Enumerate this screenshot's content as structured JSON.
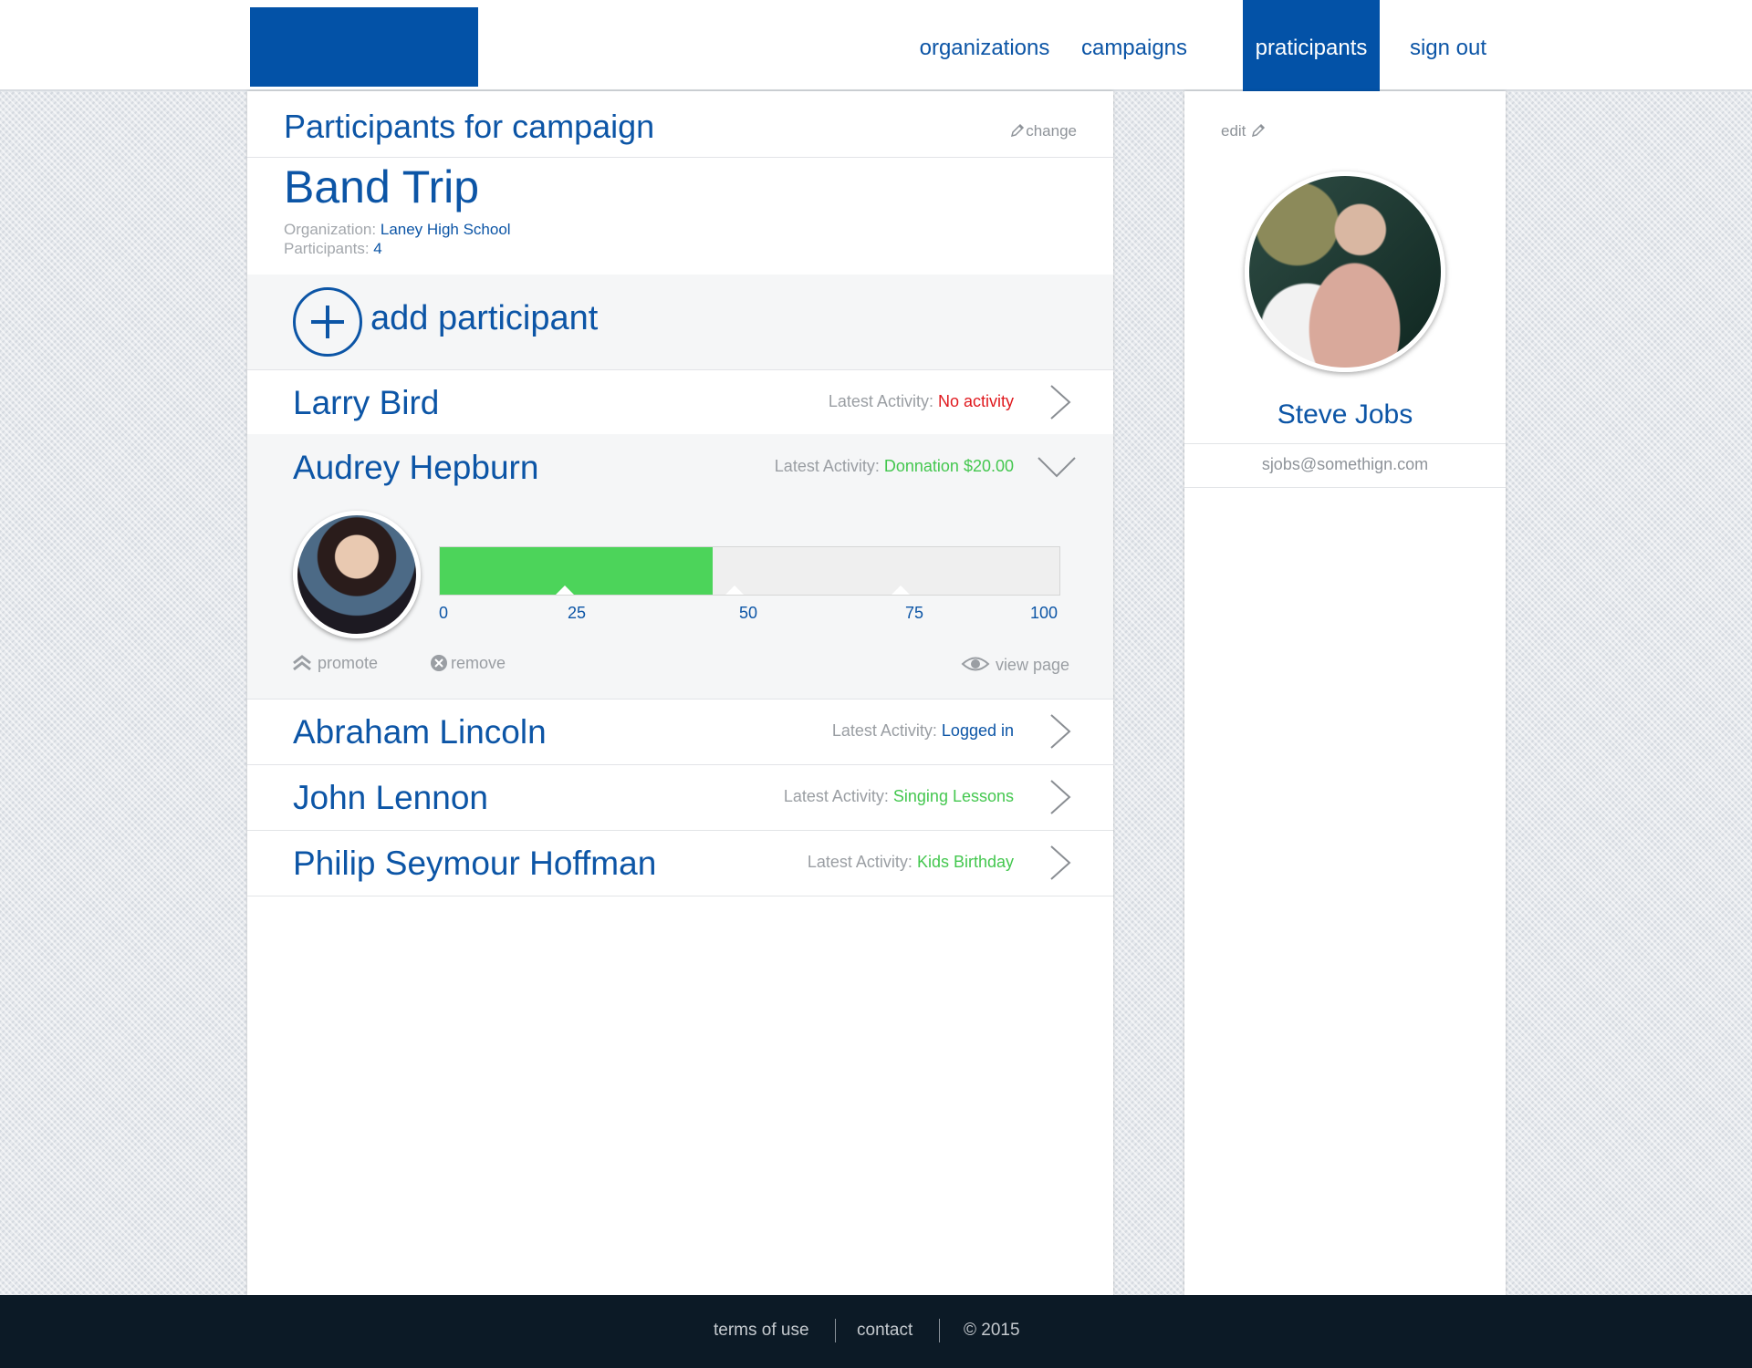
{
  "nav": {
    "items": [
      {
        "label": "organizations",
        "active": false
      },
      {
        "label": "campaigns",
        "active": false
      },
      {
        "label": "praticipants",
        "active": true
      },
      {
        "label": "sign out",
        "active": false
      }
    ]
  },
  "main": {
    "title": "Participants for campaign",
    "change_label": "change",
    "campaign_name": "Band Trip",
    "organization_label": "Organization:",
    "organization_value": "Laney High School",
    "participants_label": "Participants:",
    "participants_value": "4",
    "add_label": "add participant"
  },
  "participants": [
    {
      "name": "Larry Bird",
      "activity_label": "Latest Activity:",
      "activity_value": "No activity",
      "activity_color": "#e0191e",
      "expanded": false
    },
    {
      "name": "Audrey Hepburn",
      "activity_label": "Latest Activity:",
      "activity_value": "Donnation $20.00",
      "activity_color": "#44c74f",
      "expanded": true
    },
    {
      "name": "Abraham Lincoln",
      "activity_label": "Latest Activity:",
      "activity_value": "Logged in",
      "activity_color": "#0c55a6",
      "expanded": false
    },
    {
      "name": "John Lennon",
      "activity_label": "Latest Activity:",
      "activity_value": "Singing Lessons",
      "activity_color": "#44c74f",
      "expanded": false
    },
    {
      "name": "Philip Seymour Hoffman",
      "activity_label": "Latest Activity:",
      "activity_value": "Kids Birthday",
      "activity_color": "#44c74f",
      "expanded": false
    }
  ],
  "expanded": {
    "progress_percent": 44,
    "ticks": [
      "0",
      "25",
      "50",
      "75",
      "100"
    ],
    "promote_label": "promote",
    "remove_label": "remove",
    "view_label": "view page"
  },
  "sidebar": {
    "edit_label": "edit",
    "name": "Steve Jobs",
    "email": "sjobs@somethign.com"
  },
  "footer": {
    "terms": "terms of use",
    "contact": "contact",
    "copyright": "© 2015"
  },
  "colors": {
    "brand": "#0352a7",
    "text_blue": "#0c55a6",
    "progress_green": "#4cd45a",
    "footer_bg": "#0c1a26"
  }
}
